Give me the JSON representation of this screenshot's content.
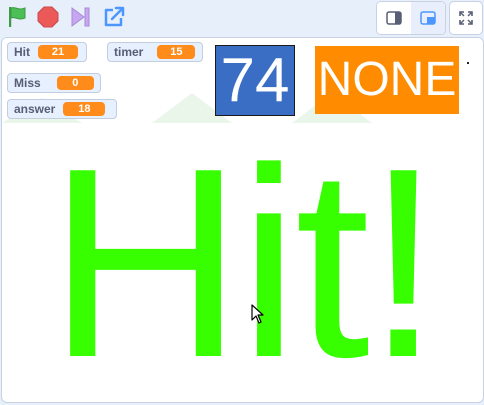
{
  "toolbar": {
    "green_flag_icon": "flag-icon",
    "stop_icon": "stop-icon",
    "turbo_icon": "turbo-icon",
    "share_icon": "share-icon",
    "small_stage_icon": "small-stage-icon",
    "large_stage_icon": "large-stage-icon",
    "fullscreen_icon": "fullscreen-icon",
    "colors": {
      "flag": "#4cbf56",
      "stop": "#ec5959",
      "turbo": "#c7a6f2",
      "accent": "#4c97ff"
    }
  },
  "monitors": {
    "hit": {
      "label": "Hit",
      "value": "21"
    },
    "timer": {
      "label": "timer",
      "value": "15"
    },
    "miss": {
      "label": "Miss",
      "value": "0"
    },
    "answer": {
      "label": "answer",
      "value": "18"
    }
  },
  "sprites": {
    "number": "74",
    "status": "NONE",
    "message": "Hit!"
  },
  "colors": {
    "number_bg": "#3a6ec5",
    "status_bg": "#ff8c00",
    "message": "#37ff00",
    "monitor_value_bg": "#ff8c1a"
  }
}
